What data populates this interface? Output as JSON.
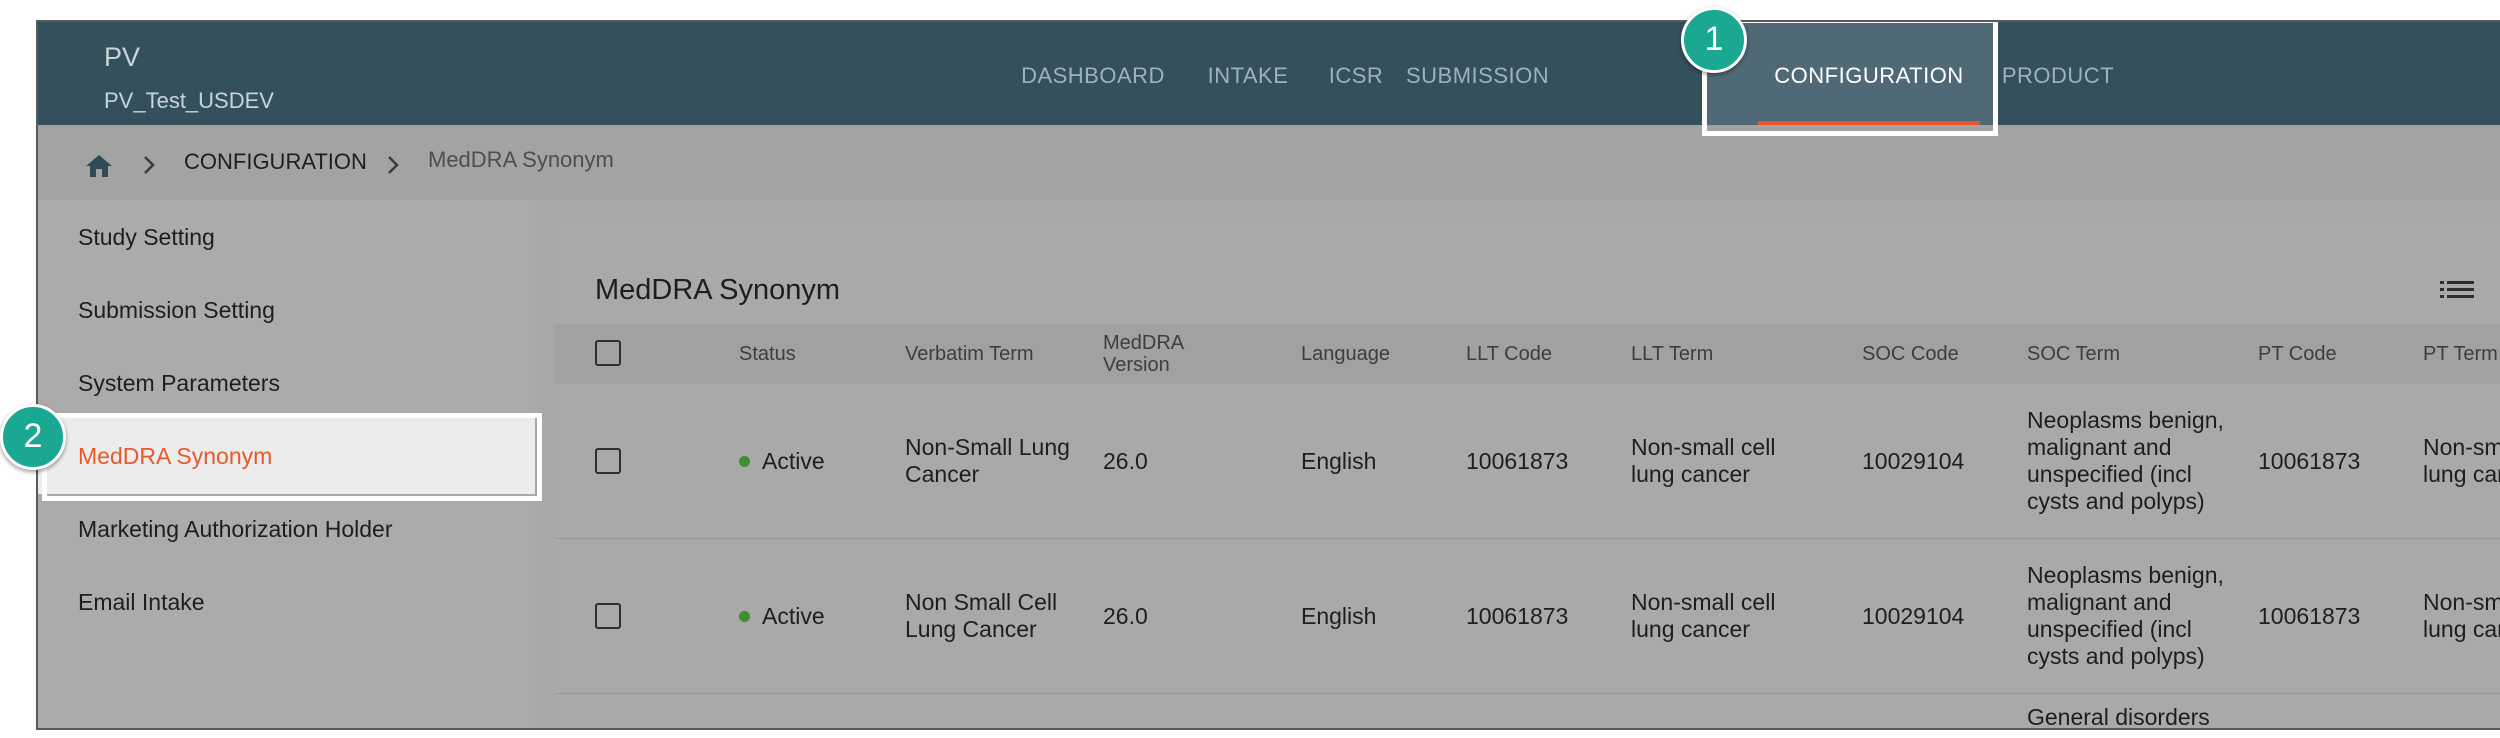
{
  "app": {
    "brand": "PV",
    "tenant": "PV_Test_USDEV"
  },
  "nav": [
    {
      "label": "DASHBOARD"
    },
    {
      "label": "INTAKE"
    },
    {
      "label": "ICSR"
    },
    {
      "label": "SUBMISSION"
    },
    {
      "label": "CONFIGURATION",
      "active": true
    },
    {
      "label": "PRODUCT"
    }
  ],
  "breadcrumb": {
    "home_icon": "home-icon",
    "section": "CONFIGURATION",
    "current": "MedDRA Synonym"
  },
  "sidebar": {
    "items": [
      {
        "label": "Study Setting"
      },
      {
        "label": "Submission Setting"
      },
      {
        "label": "System Parameters"
      },
      {
        "label": "MedDRA Synonym",
        "active": true
      },
      {
        "label": "Marketing Authorization Holder"
      },
      {
        "label": "Email Intake"
      }
    ]
  },
  "main": {
    "title": "MedDRA Synonym",
    "columns": [
      "Status",
      "Verbatim Term",
      "MedDRA Version",
      "Language",
      "LLT Code",
      "LLT Term",
      "SOC Code",
      "SOC Term",
      "PT Code",
      "PT Term"
    ],
    "rows": [
      {
        "status": "Active",
        "verbatim": "Non-Small Lung Cancer",
        "version": "26.0",
        "language": "English",
        "llt_code": "10061873",
        "llt_term": "Non-small cell lung cancer",
        "soc_code": "10029104",
        "soc_term": "Neoplasms benign, malignant and unspecified (incl cysts and polyps)",
        "pt_code": "10061873",
        "pt_term": "Non-small cell lung cancer"
      },
      {
        "status": "Active",
        "verbatim": "Non Small Cell Lung Cancer",
        "version": "26.0",
        "language": "English",
        "llt_code": "10061873",
        "llt_term": "Non-small cell lung cancer",
        "soc_code": "10029104",
        "soc_term": "Neoplasms benign, malignant and unspecified (incl cysts and polyps)",
        "pt_code": "10061873",
        "pt_term": "Non-small cell lung cancer"
      }
    ],
    "partial_row": {
      "soc_term": "General disorders"
    }
  },
  "annotations": {
    "badge_1": "1",
    "badge_2": "2"
  },
  "colors": {
    "topbar": "#34505c",
    "accent": "#e5582f",
    "badge": "#1aa892",
    "status_active": "#3f8f2e"
  }
}
